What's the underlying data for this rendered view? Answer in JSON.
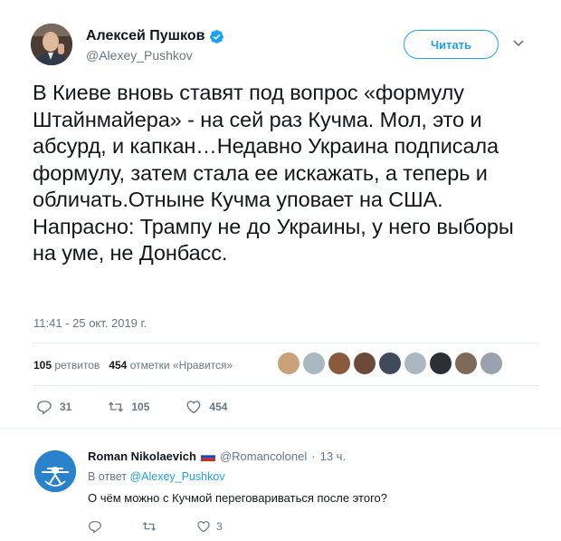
{
  "tweet": {
    "author_name": "Алексей Пушков",
    "author_handle": "@Alexey_Pushkov",
    "follow_label": "Читать",
    "text": "В Киеве вновь ставят под вопрос «формулу Штайнмайера» - на сей раз Кучма. Мол, это и абсурд, и капкан…Недавно Украина подписала формулу, затем стала ее искажать, а теперь и обличать.Отныне Кучма уповает на США. Напрасно: Трампу не до Украины, у него выборы на уме, не Донбасс.",
    "timestamp": "11:41 - 25 окт. 2019 г.",
    "stats": {
      "retweets_count": "105",
      "retweets_label": "ретвитов",
      "likes_count": "454",
      "likes_label": "отметки «Нравится»"
    },
    "actions": {
      "replies": "31",
      "retweets": "105",
      "likes": "454"
    },
    "liker_colors": [
      "#c9a27a",
      "#aab8c2",
      "#8a5a3c",
      "#6b4a3a",
      "#3f4b5c",
      "#aab8c2",
      "#2c2f33",
      "#7d6a58",
      "#9aa3ad"
    ]
  },
  "reply": {
    "name": "Roman Nikolaevich",
    "handle": "@Romancolonel",
    "separator": "·",
    "time": "13 ч.",
    "in_reply_prefix": "В ответ",
    "in_reply_handle": "@Alexey_Pushkov",
    "text": "О чём можно с Кучмой переговариваться после этого?",
    "likes": "3"
  },
  "colors": {
    "accent": "#1da1f2",
    "secondary_text": "#657786",
    "primary_text": "#14171a",
    "divider": "#e6ecf0"
  }
}
